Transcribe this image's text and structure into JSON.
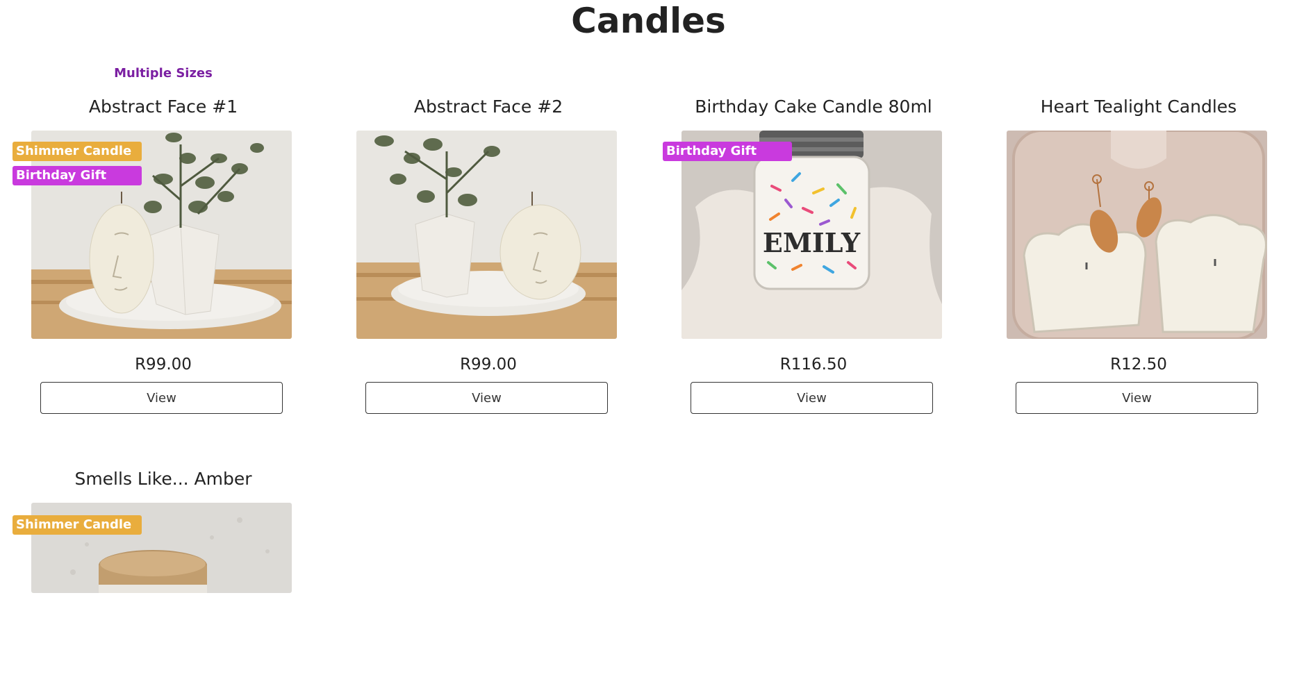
{
  "page": {
    "title": "Candles"
  },
  "products": [
    {
      "tagline": "Multiple Sizes",
      "name": "Abstract Face #1",
      "badges": [
        "Shimmer Candle",
        "Birthday Gift"
      ],
      "price": "R99.00",
      "view_label": "View"
    },
    {
      "tagline": "",
      "name": "Abstract Face #2",
      "badges": [],
      "price": "R99.00",
      "view_label": "View"
    },
    {
      "tagline": "",
      "name": "Birthday Cake Candle 80ml",
      "badges": [
        "Birthday Gift"
      ],
      "price": "R116.50",
      "view_label": "View",
      "jar_text": "EMILY"
    },
    {
      "tagline": "",
      "name": "Heart Tealight Candles",
      "badges": [],
      "price": "R12.50",
      "view_label": "View"
    },
    {
      "tagline": "",
      "name": "Smells Like... Amber",
      "badges": [
        "Shimmer Candle"
      ],
      "price": "",
      "view_label": ""
    }
  ],
  "colors": {
    "tagline": "#7b1fa2",
    "badge_shimmer": "#e9ad3d",
    "badge_gift": "#c93ade"
  }
}
